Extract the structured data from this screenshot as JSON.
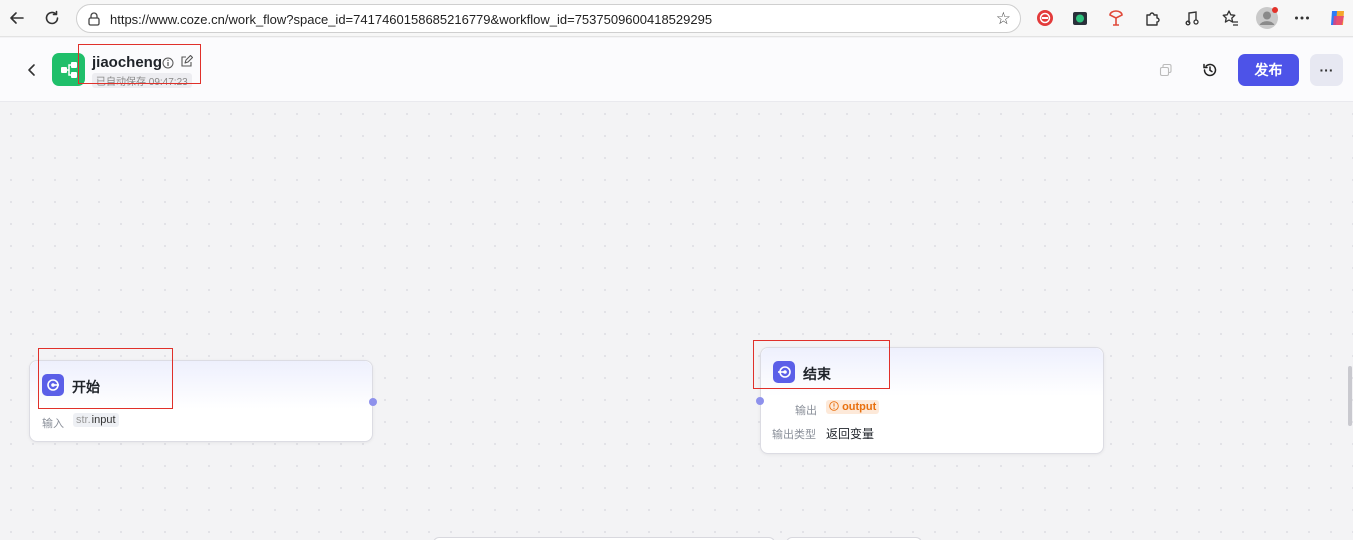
{
  "browser": {
    "url": "https://www.coze.cn/work_flow?space_id=7417460158685216779&workflow_id=7537509600418529295"
  },
  "header": {
    "title": "jiaocheng",
    "autosave_text": "已自动保存 09:47:23",
    "publish_label": "发布",
    "more_label": "···"
  },
  "nodes": {
    "start": {
      "title": "开始",
      "input_label": "输入",
      "input_type": "str.",
      "input_name": "input"
    },
    "end": {
      "title": "结束",
      "output_label": "输出",
      "output_name": "output",
      "output_type_label": "输出类型",
      "output_type_value": "返回变量"
    }
  },
  "colors": {
    "accent": "#4d53e8",
    "node_icon": "#5b5fe8",
    "logo": "#1fbf6a",
    "highlight": "#e0302a",
    "output_tag": "#e8700e"
  }
}
